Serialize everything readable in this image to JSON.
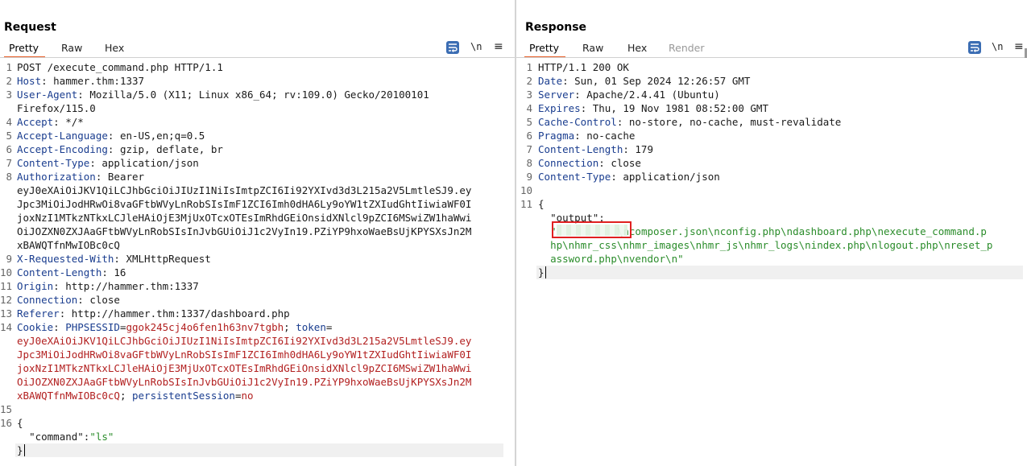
{
  "request": {
    "title": "Request",
    "tabs": [
      "Pretty",
      "Raw",
      "Hex"
    ],
    "tools": {
      "newline_label": "\\n",
      "menu_label": "≡"
    },
    "lines": [
      {
        "n": "1",
        "parts": [
          {
            "t": "POST /execute_command.php HTTP/1.1",
            "c": "plain"
          }
        ]
      },
      {
        "n": "2",
        "parts": [
          {
            "t": "Host",
            "c": "hk"
          },
          {
            "t": ": hammer.thm:1337",
            "c": "plain"
          }
        ]
      },
      {
        "n": "3",
        "parts": [
          {
            "t": "User-Agent",
            "c": "hk"
          },
          {
            "t": ": Mozilla/5.0 (X11; Linux x86_64; rv:109.0) Gecko/20100101",
            "c": "plain"
          }
        ]
      },
      {
        "n": "",
        "parts": [
          {
            "t": "Firefox/115.0",
            "c": "plain"
          }
        ]
      },
      {
        "n": "4",
        "parts": [
          {
            "t": "Accept",
            "c": "hk"
          },
          {
            "t": ": */*",
            "c": "plain"
          }
        ]
      },
      {
        "n": "5",
        "parts": [
          {
            "t": "Accept-Language",
            "c": "hk"
          },
          {
            "t": ": en-US,en;q=0.5",
            "c": "plain"
          }
        ]
      },
      {
        "n": "6",
        "parts": [
          {
            "t": "Accept-Encoding",
            "c": "hk"
          },
          {
            "t": ": gzip, deflate, br",
            "c": "plain"
          }
        ]
      },
      {
        "n": "7",
        "parts": [
          {
            "t": "Content-Type",
            "c": "hk"
          },
          {
            "t": ": application/json",
            "c": "plain"
          }
        ]
      },
      {
        "n": "8",
        "parts": [
          {
            "t": "Authorization",
            "c": "hk"
          },
          {
            "t": ": Bearer",
            "c": "plain"
          }
        ]
      },
      {
        "n": "",
        "parts": [
          {
            "t": "eyJ0eXAiOiJKV1QiLCJhbGciOiJIUzI1NiIsImtpZCI6Ii92YXIvd3d3L215a2V5LmtleSJ9.ey",
            "c": "plain"
          }
        ]
      },
      {
        "n": "",
        "parts": [
          {
            "t": "Jpc3MiOiJodHRwOi8vaGFtbWVyLnRobSIsImF1ZCI6Imh0dHA6Ly9oYW1tZXIudGhtIiwiaWF0I",
            "c": "plain"
          }
        ]
      },
      {
        "n": "",
        "parts": [
          {
            "t": "joxNzI1MTkzNTkxLCJleHAiOjE3MjUxOTcxOTEsImRhdGEiOnsidXNlcl9pZCI6MSwiZW1haWwi",
            "c": "plain"
          }
        ]
      },
      {
        "n": "",
        "parts": [
          {
            "t": "OiJOZXN0ZXJAaGFtbWVyLnRobSIsInJvbGUiOiJ1c2VyIn19.PZiYP9hxoWaeBsUjKPYSXsJn2M",
            "c": "plain"
          }
        ]
      },
      {
        "n": "",
        "parts": [
          {
            "t": "xBAWQTfnMwIOBc0cQ",
            "c": "plain"
          }
        ]
      },
      {
        "n": "9",
        "parts": [
          {
            "t": "X-Requested-With",
            "c": "hk"
          },
          {
            "t": ": XMLHttpRequest",
            "c": "plain"
          }
        ]
      },
      {
        "n": "10",
        "parts": [
          {
            "t": "Content-Length",
            "c": "hk"
          },
          {
            "t": ": 16",
            "c": "plain"
          }
        ]
      },
      {
        "n": "11",
        "parts": [
          {
            "t": "Origin",
            "c": "hk"
          },
          {
            "t": ": http://hammer.thm:1337",
            "c": "plain"
          }
        ]
      },
      {
        "n": "12",
        "parts": [
          {
            "t": "Connection",
            "c": "hk"
          },
          {
            "t": ": close",
            "c": "plain"
          }
        ]
      },
      {
        "n": "13",
        "parts": [
          {
            "t": "Referer",
            "c": "hk"
          },
          {
            "t": ": http://hammer.thm:1337/dashboard.php",
            "c": "plain"
          }
        ]
      },
      {
        "n": "14",
        "parts": [
          {
            "t": "Cookie",
            "c": "hk"
          },
          {
            "t": ": ",
            "c": "plain"
          },
          {
            "t": "PHPSESSID",
            "c": "hk"
          },
          {
            "t": "=",
            "c": "plain"
          },
          {
            "t": "ggok245cj4o6fen1h63nv7tgbh",
            "c": "cv"
          },
          {
            "t": "; ",
            "c": "plain"
          },
          {
            "t": "token",
            "c": "hk"
          },
          {
            "t": "=",
            "c": "plain"
          }
        ]
      },
      {
        "n": "",
        "parts": [
          {
            "t": "eyJ0eXAiOiJKV1QiLCJhbGciOiJIUzI1NiIsImtpZCI6Ii92YXIvd3d3L215a2V5LmtleSJ9.ey",
            "c": "cv"
          }
        ]
      },
      {
        "n": "",
        "parts": [
          {
            "t": "Jpc3MiOiJodHRwOi8vaGFtbWVyLnRobSIsImF1ZCI6Imh0dHA6Ly9oYW1tZXIudGhtIiwiaWF0I",
            "c": "cv"
          }
        ]
      },
      {
        "n": "",
        "parts": [
          {
            "t": "joxNzI1MTkzNTkxLCJleHAiOjE3MjUxOTcxOTEsImRhdGEiOnsidXNlcl9pZCI6MSwiZW1haWwi",
            "c": "cv"
          }
        ]
      },
      {
        "n": "",
        "parts": [
          {
            "t": "OiJOZXN0ZXJAaGFtbWVyLnRobSIsInJvbGUiOiJ1c2VyIn19.PZiYP9hxoWaeBsUjKPYSXsJn2M",
            "c": "cv"
          }
        ]
      },
      {
        "n": "",
        "parts": [
          {
            "t": "xBAWQTfnMwIOBc0cQ",
            "c": "cv"
          },
          {
            "t": "; ",
            "c": "plain"
          },
          {
            "t": "persistentSession",
            "c": "hk"
          },
          {
            "t": "=",
            "c": "plain"
          },
          {
            "t": "no",
            "c": "cv"
          }
        ]
      },
      {
        "n": "15",
        "parts": [
          {
            "t": "",
            "c": "plain"
          }
        ]
      },
      {
        "n": "16",
        "parts": [
          {
            "t": "{",
            "c": "plain"
          }
        ]
      },
      {
        "n": "",
        "parts": [
          {
            "t": "  ",
            "c": "plain"
          },
          {
            "t": "\"command\"",
            "c": "jk"
          },
          {
            "t": ":",
            "c": "plain"
          },
          {
            "t": "\"ls\"",
            "c": "js"
          }
        ]
      },
      {
        "n": "",
        "parts": [
          {
            "t": "}",
            "c": "plain"
          }
        ],
        "current": true
      }
    ]
  },
  "response": {
    "title": "Response",
    "tabs": [
      "Pretty",
      "Raw",
      "Hex",
      "Render"
    ],
    "tools": {
      "newline_label": "\\n",
      "menu_label": "≡"
    },
    "lines": [
      {
        "n": "1",
        "parts": [
          {
            "t": "HTTP/1.1 200 OK",
            "c": "plain"
          }
        ]
      },
      {
        "n": "2",
        "parts": [
          {
            "t": "Date",
            "c": "hk"
          },
          {
            "t": ": Sun, 01 Sep 2024 12:26:57 GMT",
            "c": "plain"
          }
        ]
      },
      {
        "n": "3",
        "parts": [
          {
            "t": "Server",
            "c": "hk"
          },
          {
            "t": ": Apache/2.4.41 (Ubuntu)",
            "c": "plain"
          }
        ]
      },
      {
        "n": "4",
        "parts": [
          {
            "t": "Expires",
            "c": "hk"
          },
          {
            "t": ": Thu, 19 Nov 1981 08:52:00 GMT",
            "c": "plain"
          }
        ]
      },
      {
        "n": "5",
        "parts": [
          {
            "t": "Cache-Control",
            "c": "hk"
          },
          {
            "t": ": no-store, no-cache, must-revalidate",
            "c": "plain"
          }
        ]
      },
      {
        "n": "6",
        "parts": [
          {
            "t": "Pragma",
            "c": "hk"
          },
          {
            "t": ": no-cache",
            "c": "plain"
          }
        ]
      },
      {
        "n": "7",
        "parts": [
          {
            "t": "Content-Length",
            "c": "hk"
          },
          {
            "t": ": 179",
            "c": "plain"
          }
        ]
      },
      {
        "n": "8",
        "parts": [
          {
            "t": "Connection",
            "c": "hk"
          },
          {
            "t": ": close",
            "c": "plain"
          }
        ]
      },
      {
        "n": "9",
        "parts": [
          {
            "t": "Content-Type",
            "c": "hk"
          },
          {
            "t": ": application/json",
            "c": "plain"
          }
        ]
      },
      {
        "n": "10",
        "parts": [
          {
            "t": "",
            "c": "plain"
          }
        ]
      },
      {
        "n": "11",
        "parts": [
          {
            "t": "{",
            "c": "plain"
          }
        ]
      },
      {
        "n": "",
        "parts": [
          {
            "t": "  ",
            "c": "plain"
          },
          {
            "t": "\"output\"",
            "c": "jk"
          },
          {
            "t": ":",
            "c": "plain"
          }
        ]
      },
      {
        "n": "",
        "parts": [
          {
            "t": "  ",
            "c": "plain"
          },
          {
            "t": "\"          \\ncomposer.json\\nconfig.php\\ndashboard.php\\nexecute_command.p",
            "c": "js"
          }
        ]
      },
      {
        "n": "",
        "parts": [
          {
            "t": "  ",
            "c": "plain"
          },
          {
            "t": "hp\\nhmr_css\\nhmr_images\\nhmr_js\\nhmr_logs\\nindex.php\\nlogout.php\\nreset_p",
            "c": "js"
          }
        ]
      },
      {
        "n": "",
        "parts": [
          {
            "t": "  ",
            "c": "plain"
          },
          {
            "t": "assword.php\\nvendor\\n\"",
            "c": "js"
          }
        ]
      },
      {
        "n": "",
        "parts": [
          {
            "t": "}",
            "c": "plain"
          }
        ],
        "current": true
      }
    ]
  },
  "colors": {
    "accent": "#e8612c",
    "header_key": "#1a3d8f",
    "cookie_value": "#b21f1f",
    "json_string": "#2a8c2a",
    "highlight": "#e02020"
  },
  "icons": [
    "wrap-icon",
    "newline-toggle",
    "menu-icon",
    "layout-side-by-side-icon",
    "layout-top-bottom-icon",
    "layout-tabs-icon"
  ]
}
